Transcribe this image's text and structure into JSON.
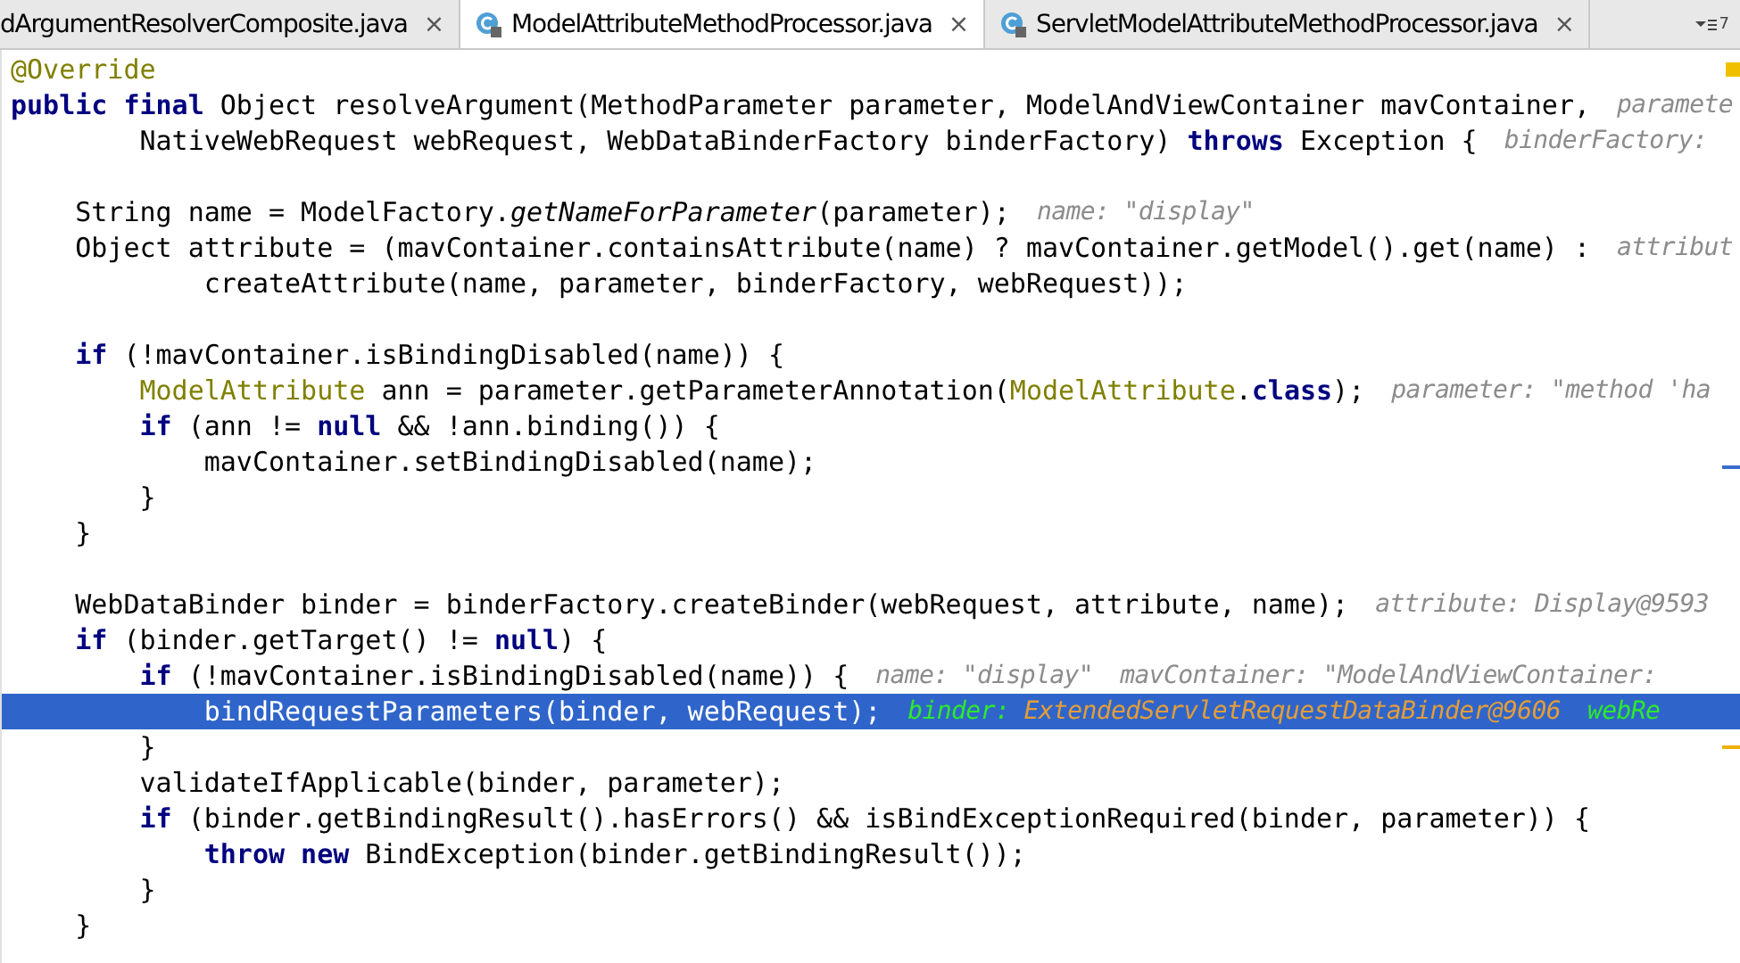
{
  "tabs": [
    {
      "label": "dArgumentResolverComposite.java",
      "icon": false,
      "selected": false,
      "close": "×"
    },
    {
      "label": "ModelAttributeMethodProcessor.java",
      "icon": true,
      "selected": true,
      "close": "×"
    },
    {
      "label": "ServletModelAttributeMethodProcessor.java",
      "icon": true,
      "selected": false,
      "close": "×"
    }
  ],
  "hidden_tab_count": "7",
  "lines": [
    {
      "selected": false,
      "code": [
        {
          "kind": "annotation",
          "text": "@Override"
        }
      ]
    },
    {
      "selected": false,
      "code": [
        {
          "kind": "keyword",
          "text": "public final"
        },
        {
          "kind": "plain",
          "text": " Object resolveArgument(MethodParameter parameter, ModelAndViewContainer mavContainer,"
        }
      ],
      "hints": [
        [
          {
            "kind": "label",
            "text": "paramete"
          }
        ]
      ]
    },
    {
      "selected": false,
      "code": [
        {
          "kind": "plain",
          "text": "        NativeWebRequest webRequest, WebDataBinderFactory binderFactory) "
        },
        {
          "kind": "keyword",
          "text": "throws"
        },
        {
          "kind": "plain",
          "text": " Exception {"
        }
      ],
      "hints": [
        [
          {
            "kind": "label",
            "text": "binderFactory:"
          }
        ]
      ]
    },
    {
      "selected": false
    },
    {
      "selected": false,
      "code": [
        {
          "kind": "plain",
          "text": "    String name = ModelFactory."
        },
        {
          "kind": "italic",
          "text": "getNameForParameter"
        },
        {
          "kind": "plain",
          "text": "(parameter);"
        }
      ],
      "hints": [
        [
          {
            "kind": "label",
            "text": "name:"
          },
          {
            "kind": "value",
            "text": "\"display\""
          }
        ]
      ]
    },
    {
      "selected": false,
      "code": [
        {
          "kind": "plain",
          "text": "    Object attribute = (mavContainer.containsAttribute(name) ? mavContainer.getModel().get(name) :"
        }
      ],
      "hints": [
        [
          {
            "kind": "label",
            "text": "attribut"
          }
        ]
      ]
    },
    {
      "selected": false,
      "code": [
        {
          "kind": "plain",
          "text": "            createAttribute(name, parameter, binderFactory, webRequest));"
        }
      ]
    },
    {
      "selected": false
    },
    {
      "selected": false,
      "code": [
        {
          "kind": "keyword",
          "text": "    if"
        },
        {
          "kind": "plain",
          "text": " (!mavContainer.isBindingDisabled(name)) {"
        }
      ]
    },
    {
      "selected": false,
      "code": [
        {
          "kind": "annotation",
          "text": "        ModelAttribute"
        },
        {
          "kind": "plain",
          "text": " ann = parameter.getParameterAnnotation("
        },
        {
          "kind": "annotation",
          "text": "ModelAttribute"
        },
        {
          "kind": "plain",
          "text": "."
        },
        {
          "kind": "keyword",
          "text": "class"
        },
        {
          "kind": "plain",
          "text": ");"
        }
      ],
      "hints": [
        [
          {
            "kind": "label",
            "text": "parameter:"
          },
          {
            "kind": "value",
            "text": "\"method 'ha"
          }
        ]
      ]
    },
    {
      "selected": false,
      "code": [
        {
          "kind": "keyword",
          "text": "        if"
        },
        {
          "kind": "plain",
          "text": " (ann != "
        },
        {
          "kind": "keyword",
          "text": "null"
        },
        {
          "kind": "plain",
          "text": " && !ann.binding()) {"
        }
      ]
    },
    {
      "selected": false,
      "code": [
        {
          "kind": "plain",
          "text": "            mavContainer.setBindingDisabled(name);"
        }
      ]
    },
    {
      "selected": false,
      "code": [
        {
          "kind": "plain",
          "text": "        }"
        }
      ]
    },
    {
      "selected": false,
      "code": [
        {
          "kind": "plain",
          "text": "    }"
        }
      ]
    },
    {
      "selected": false
    },
    {
      "selected": false,
      "code": [
        {
          "kind": "plain",
          "text": "    WebDataBinder binder = binderFactory.createBinder(webRequest, attribute, name);"
        }
      ],
      "hints": [
        [
          {
            "kind": "label",
            "text": "attribute:"
          },
          {
            "kind": "value",
            "text": "Display@9593"
          }
        ]
      ]
    },
    {
      "selected": false,
      "code": [
        {
          "kind": "keyword",
          "text": "    if"
        },
        {
          "kind": "plain",
          "text": " (binder.getTarget() != "
        },
        {
          "kind": "keyword",
          "text": "null"
        },
        {
          "kind": "plain",
          "text": ") {"
        }
      ]
    },
    {
      "selected": false,
      "code": [
        {
          "kind": "keyword",
          "text": "        if"
        },
        {
          "kind": "plain",
          "text": " (!mavContainer.isBindingDisabled(name)) {"
        }
      ],
      "hints": [
        [
          {
            "kind": "label",
            "text": "name:"
          },
          {
            "kind": "value",
            "text": "\"display\""
          }
        ],
        [
          {
            "kind": "label",
            "text": "mavContainer:"
          },
          {
            "kind": "value",
            "text": "\"ModelAndViewContainer:"
          }
        ]
      ]
    },
    {
      "selected": true,
      "code": [
        {
          "kind": "plain",
          "text": "            bindRequestParameters(binder, webRequest);"
        }
      ],
      "hints": [
        [
          {
            "kind": "label",
            "text": "binder:"
          },
          {
            "kind": "value",
            "text": "ExtendedServletRequestDataBinder@9606"
          }
        ],
        [
          {
            "kind": "label",
            "text": "webRe"
          }
        ]
      ]
    },
    {
      "selected": false,
      "code": [
        {
          "kind": "plain",
          "text": "        }"
        }
      ]
    },
    {
      "selected": false,
      "code": [
        {
          "kind": "plain",
          "text": "        validateIfApplicable(binder, parameter);"
        }
      ]
    },
    {
      "selected": false,
      "code": [
        {
          "kind": "keyword",
          "text": "        if"
        },
        {
          "kind": "plain",
          "text": " (binder.getBindingResult().hasErrors() && isBindExceptionRequired(binder, parameter)) {"
        }
      ]
    },
    {
      "selected": false,
      "code": [
        {
          "kind": "keyword",
          "text": "            throw new"
        },
        {
          "kind": "plain",
          "text": " BindException(binder.getBindingResult());"
        }
      ]
    },
    {
      "selected": false,
      "code": [
        {
          "kind": "plain",
          "text": "        }"
        }
      ]
    },
    {
      "selected": false,
      "code": [
        {
          "kind": "plain",
          "text": "    }"
        }
      ]
    }
  ]
}
